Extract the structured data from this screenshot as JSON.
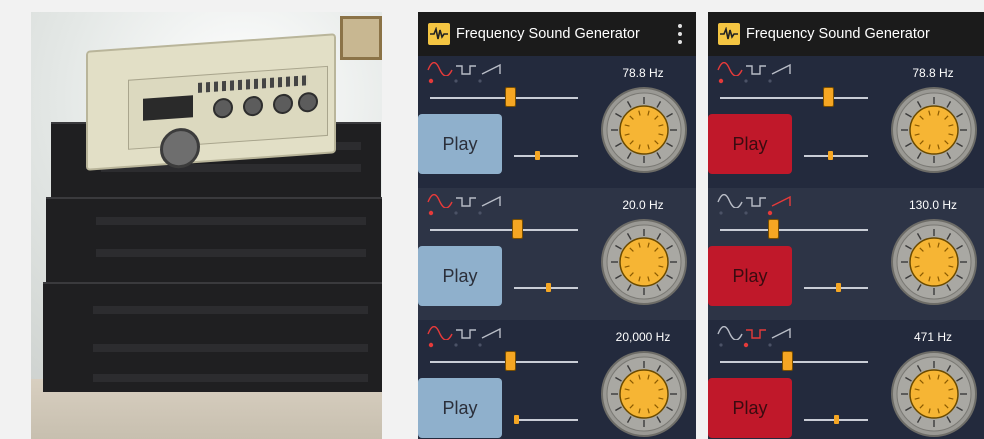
{
  "app": {
    "title": "Frequency Sound Generator"
  },
  "colors": {
    "accent": "#f5a623",
    "play_idle": "#8fb0cc",
    "play_active": "#c0182a",
    "background": "#232a3d",
    "wave_active": "#e53a3a",
    "wave_inactive": "#b8bcc6"
  },
  "screens": [
    {
      "generators": [
        {
          "frequency": "78.8 Hz",
          "play_label": "Play",
          "playing": false,
          "wave": "sine",
          "freq_level": 0.55,
          "vol_level": 0.35
        },
        {
          "frequency": "20.0 Hz",
          "play_label": "Play",
          "playing": false,
          "wave": "sine",
          "freq_level": 0.6,
          "vol_level": 0.55
        },
        {
          "frequency": "20,000 Hz",
          "play_label": "Play",
          "playing": false,
          "wave": "sine",
          "freq_level": 0.55,
          "vol_level": 0.0
        }
      ]
    },
    {
      "generators": [
        {
          "frequency": "78.8 Hz",
          "play_label": "Play",
          "playing": true,
          "wave": "sine",
          "freq_level": 0.75,
          "vol_level": 0.4
        },
        {
          "frequency": "130.0 Hz",
          "play_label": "Play",
          "playing": true,
          "wave": "sawtooth",
          "freq_level": 0.35,
          "vol_level": 0.55
        },
        {
          "frequency": "471 Hz",
          "play_label": "Play",
          "playing": true,
          "wave": "square",
          "freq_level": 0.45,
          "vol_level": 0.5
        }
      ]
    }
  ]
}
